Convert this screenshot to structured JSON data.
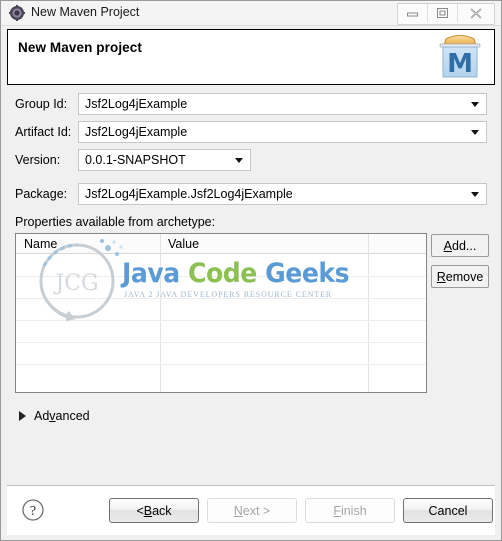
{
  "window": {
    "title": "New Maven Project",
    "icon": "eclipse-cog-icon",
    "controls": {
      "minimize": "minimize-icon",
      "restore": "restore-icon",
      "close": "close-icon"
    }
  },
  "header": {
    "title": "New Maven project",
    "logo": "maven-logo-icon"
  },
  "form": {
    "fields": [
      {
        "label": "Group Id:",
        "value": "Jsf2Log4jExample"
      },
      {
        "label": "Artifact Id:",
        "value": "Jsf2Log4jExample"
      },
      {
        "label": "Version:",
        "value": "0.0.1-SNAPSHOT"
      },
      {
        "label": "Package:",
        "value": "Jsf2Log4jExample.Jsf2Log4jExample"
      }
    ]
  },
  "properties": {
    "section_label": "Properties available from archetype:",
    "columns": [
      "Name",
      "Value"
    ],
    "rows": [],
    "buttons": {
      "add": {
        "prefix": "A",
        "mnemonic": "",
        "text_before": "",
        "label": "Add...",
        "mnemonic_char": "A",
        "rest": "dd..."
      },
      "remove": {
        "label": "Remove",
        "mnemonic_char": "R",
        "rest": "emove"
      }
    }
  },
  "watermark": {
    "logo_text": "JCG",
    "word1": "Java",
    "word2": "Code",
    "word3": "Geeks",
    "tagline": "JAVA 2 JAVA DEVELOPERS RESOURCE CENTER",
    "color_blue": "#5b9bd5",
    "color_green": "#8cc152"
  },
  "advanced": {
    "label_before": "Ad",
    "label_mnemonic": "v",
    "label_after": "anced",
    "expanded": false
  },
  "footer": {
    "help": "help-icon",
    "buttons": [
      {
        "label": "< Back",
        "prefix": "< ",
        "mnemonic_char": "B",
        "rest": "ack",
        "enabled": true
      },
      {
        "label": "Next >",
        "prefix": "",
        "mnemonic_char": "N",
        "rest": "ext >",
        "enabled": false
      },
      {
        "label": "Finish",
        "prefix": "",
        "mnemonic_char": "F",
        "rest": "inish",
        "enabled": false
      },
      {
        "label": "Cancel",
        "prefix": "",
        "mnemonic_char": "",
        "rest": "Cancel",
        "enabled": true
      }
    ]
  }
}
